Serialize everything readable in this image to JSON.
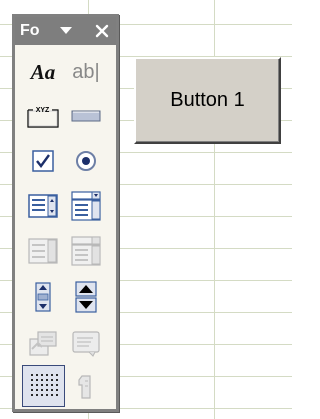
{
  "toolbar": {
    "title": "Fo",
    "dropdown_icon": "triangle-down-icon",
    "close_icon": "close-icon",
    "tools": [
      {
        "name": "label-tool",
        "icon": "label-aa-icon",
        "glyph": "Aa",
        "enabled": true
      },
      {
        "name": "edit-box-tool",
        "icon": "edit-box-ab-icon",
        "glyph": "ab|",
        "enabled": false
      },
      {
        "name": "group-box-tool",
        "icon": "group-box-icon",
        "caption": "XYZ",
        "enabled": true
      },
      {
        "name": "button-tool",
        "icon": "command-button-icon",
        "enabled": true
      },
      {
        "name": "check-box-tool",
        "icon": "checkbox-icon",
        "enabled": true
      },
      {
        "name": "option-button-tool",
        "icon": "radio-icon",
        "enabled": true
      },
      {
        "name": "list-box-tool",
        "icon": "list-box-icon",
        "enabled": true
      },
      {
        "name": "combo-box-tool",
        "icon": "combo-box-icon",
        "enabled": true
      },
      {
        "name": "combo-list-edit-tool",
        "icon": "combo-list-edit-icon",
        "enabled": false
      },
      {
        "name": "combo-dropdown-edit-tool",
        "icon": "combo-dropdown-edit-icon",
        "enabled": false
      },
      {
        "name": "scroll-bar-tool",
        "icon": "scroll-bar-icon",
        "enabled": true
      },
      {
        "name": "spinner-tool",
        "icon": "spinner-icon",
        "enabled": true
      },
      {
        "name": "control-properties-tool",
        "icon": "control-properties-icon",
        "enabled": false
      },
      {
        "name": "edit-code-tool",
        "icon": "edit-code-icon",
        "enabled": false
      },
      {
        "name": "toggle-grid-tool",
        "icon": "toggle-grid-icon",
        "enabled": true,
        "selected": true
      },
      {
        "name": "run-dialog-tool",
        "icon": "run-dialog-icon",
        "enabled": false
      }
    ]
  },
  "sheet_button": {
    "label": "Button 1"
  },
  "colors": {
    "titlebar": "#7e7e7e",
    "toolbar_bg": "#f7f5ee",
    "gridline": "#d4dbc4",
    "button_face": "#d4d0c8",
    "icon_blue": "#3a5f9f"
  }
}
